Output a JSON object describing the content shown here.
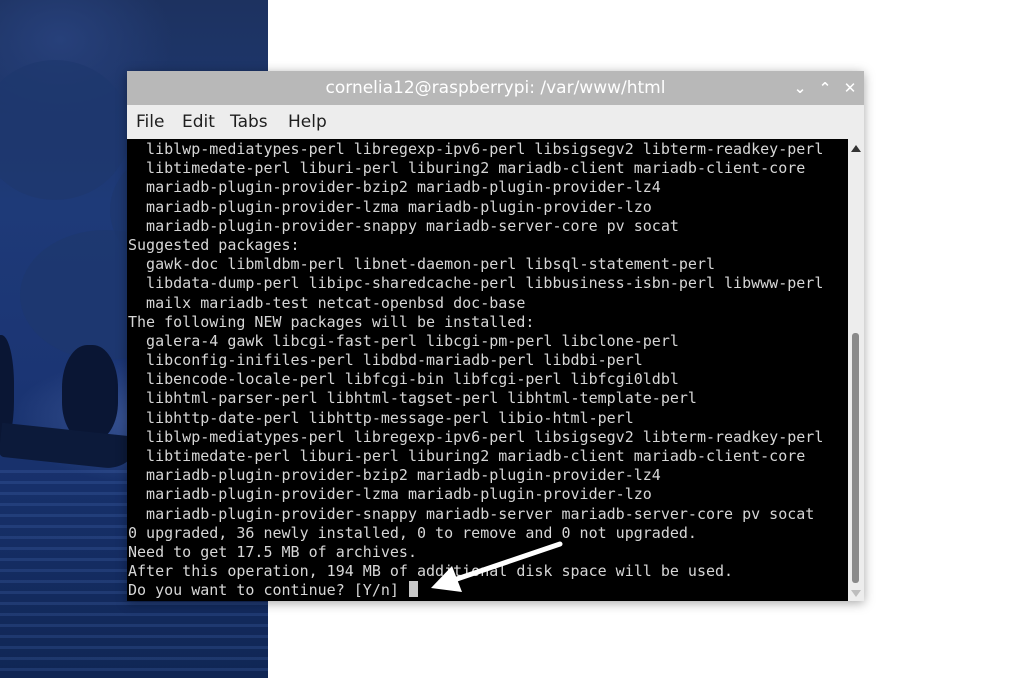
{
  "window": {
    "title": "cornelia12@raspberrypi: /var/www/html",
    "controls": {
      "minimize": "⌄",
      "maximize": "⌃",
      "close": "✕"
    }
  },
  "menu": {
    "file": "File",
    "edit": "Edit",
    "tabs": "Tabs",
    "help": "Help"
  },
  "terminal": {
    "lines": [
      "  liblwp-mediatypes-perl libregexp-ipv6-perl libsigsegv2 libterm-readkey-perl",
      "  libtimedate-perl liburi-perl liburing2 mariadb-client mariadb-client-core",
      "  mariadb-plugin-provider-bzip2 mariadb-plugin-provider-lz4",
      "  mariadb-plugin-provider-lzma mariadb-plugin-provider-lzo",
      "  mariadb-plugin-provider-snappy mariadb-server-core pv socat",
      "Suggested packages:",
      "  gawk-doc libmldbm-perl libnet-daemon-perl libsql-statement-perl",
      "  libdata-dump-perl libipc-sharedcache-perl libbusiness-isbn-perl libwww-perl",
      "  mailx mariadb-test netcat-openbsd doc-base",
      "The following NEW packages will be installed:",
      "  galera-4 gawk libcgi-fast-perl libcgi-pm-perl libclone-perl",
      "  libconfig-inifiles-perl libdbd-mariadb-perl libdbi-perl",
      "  libencode-locale-perl libfcgi-bin libfcgi-perl libfcgi0ldbl",
      "  libhtml-parser-perl libhtml-tagset-perl libhtml-template-perl",
      "  libhttp-date-perl libhttp-message-perl libio-html-perl",
      "  liblwp-mediatypes-perl libregexp-ipv6-perl libsigsegv2 libterm-readkey-perl",
      "  libtimedate-perl liburi-perl liburing2 mariadb-client mariadb-client-core",
      "  mariadb-plugin-provider-bzip2 mariadb-plugin-provider-lz4",
      "  mariadb-plugin-provider-lzma mariadb-plugin-provider-lzo",
      "  mariadb-plugin-provider-snappy mariadb-server mariadb-server-core pv socat",
      "0 upgraded, 36 newly installed, 0 to remove and 0 not upgraded.",
      "Need to get 17.5 MB of archives.",
      "After this operation, 194 MB of additional disk space will be used."
    ],
    "prompt": "Do you want to continue? [Y/n] "
  },
  "colors": {
    "titlebar": "#b8b8b8",
    "menubar": "#ededed",
    "terminal_bg": "#000000",
    "terminal_fg": "#d6d6d6",
    "annotation_arrow": "#ffffff"
  },
  "icons": {
    "minimize": "chevron-down-icon",
    "maximize": "chevron-up-icon",
    "close": "close-icon",
    "scroll_up": "scroll-up-arrow-icon",
    "scroll_down": "scroll-down-arrow-icon",
    "annotation": "pointer-arrow-icon"
  }
}
